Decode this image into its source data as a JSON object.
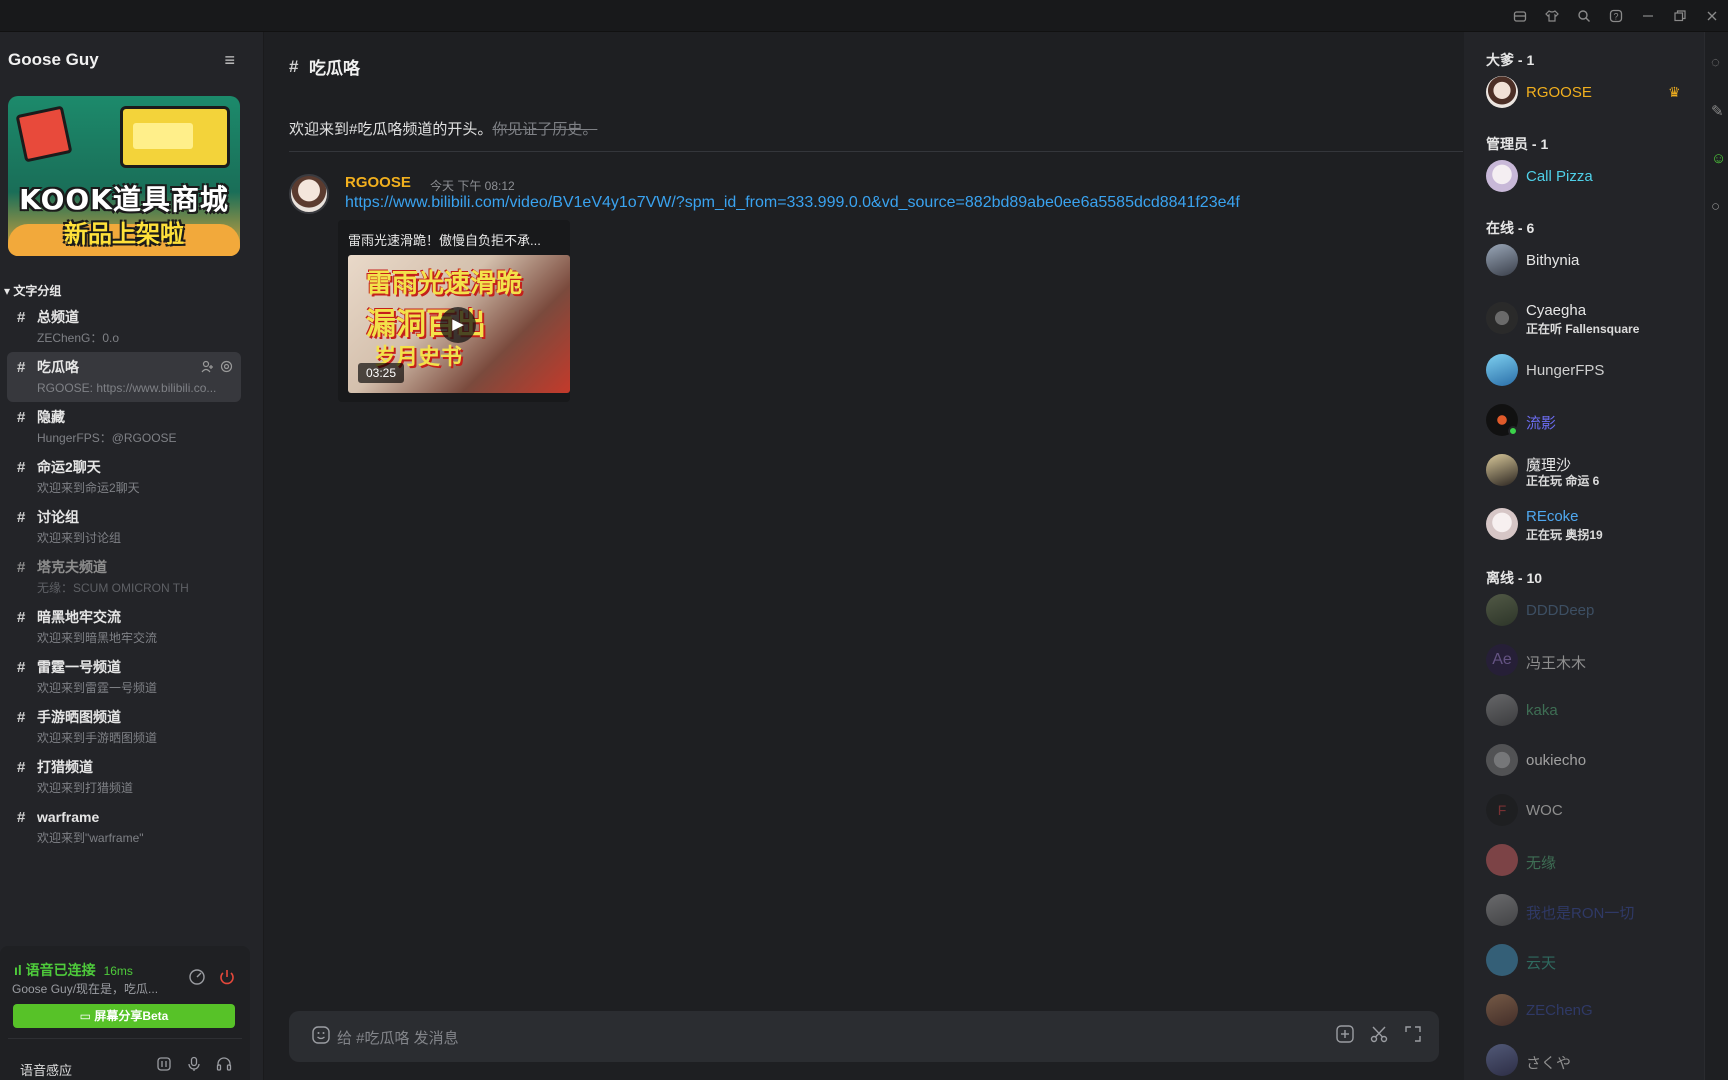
{
  "titlebar": {
    "icons": [
      "inbox-icon",
      "shirt-icon",
      "search-icon",
      "help-icon",
      "minimize-icon",
      "restore-icon",
      "close-icon"
    ]
  },
  "sidebar": {
    "server_name": "Goose Guy",
    "banner": {
      "line1": "KOOK道具商城",
      "line2": "新品上架啦"
    },
    "group_label": "文字分组",
    "channels": [
      {
        "name": "总频道",
        "sub": "ZEChenG：0.o"
      },
      {
        "name": "吃瓜咯",
        "sub": "RGOOSE: https://www.bilibili.co..."
      },
      {
        "name": "隐藏",
        "sub": "HungerFPS：@RGOOSE"
      },
      {
        "name": "命运2聊天",
        "sub": "欢迎来到命运2聊天"
      },
      {
        "name": "讨论组",
        "sub": "欢迎来到讨论组"
      },
      {
        "name": "塔克夫频道",
        "sub": "无缘：SCUM OMICRON TH"
      },
      {
        "name": "暗黑地牢交流",
        "sub": "欢迎来到暗黑地牢交流"
      },
      {
        "name": "雷霆一号频道",
        "sub": "欢迎来到雷霆一号频道"
      },
      {
        "name": "手游晒图频道",
        "sub": "欢迎来到手游晒图频道"
      },
      {
        "name": "打猎频道",
        "sub": "欢迎来到打猎频道"
      },
      {
        "name": "warframe",
        "sub": "欢迎来到\"warframe\""
      }
    ],
    "voice": {
      "status": "语音已连接",
      "ping": "16ms",
      "desc": "Goose Guy/现在是，吃瓜...",
      "share_label": "屏幕分享Beta",
      "mode": "语音感应"
    }
  },
  "main": {
    "channel_title": "吃瓜咯",
    "welcome": "欢迎来到#吃瓜咯频道的开头。",
    "welcome_strike": "你见证了历史。",
    "message": {
      "user": "RGOOSE",
      "time": "今天 下午 08:12",
      "link": "https://www.bilibili.com/video/BV1eV4y1o7VW/?spm_id_from=333.999.0.0&vd_source=882bd89abe0ee6a5585dcd8841f23e4f",
      "embed_title": "雷雨光速滑跪！傲慢自负拒不承...",
      "thumb_line1": "雷雨光速滑跪",
      "thumb_line2": "漏洞百出",
      "thumb_line3": "岁月史书",
      "duration": "03:25"
    },
    "composer_placeholder": "给 #吃瓜咯 发消息"
  },
  "members": {
    "groups": [
      {
        "label": "大爹 - 1"
      },
      {
        "label": "管理员 - 1"
      },
      {
        "label": "在线 - 6"
      },
      {
        "label": "离线 - 10"
      }
    ],
    "items": [
      {
        "name": "RGOOSE",
        "color": "#f2b01e",
        "activity": ""
      },
      {
        "name": "Call Pizza",
        "color": "#4fd0e8",
        "activity": ""
      },
      {
        "name": "Bithynia",
        "color": "#e6e6e6",
        "activity": ""
      },
      {
        "name": "Cyaegha",
        "color": "#e6e6e6",
        "activity": "正在听 Fallensquare"
      },
      {
        "name": "HungerFPS",
        "color": "#cfcfcf",
        "activity": ""
      },
      {
        "name": "流影",
        "color": "#6b6cf0",
        "activity": ""
      },
      {
        "name": "魔理沙",
        "color": "#e6e6e6",
        "activity": "正在玩 命运 6"
      },
      {
        "name": "REcoke",
        "color": "#4fa8f0",
        "activity": "正在玩 奥拐19"
      },
      {
        "name": "DDDDeep",
        "color": "#3d4f63",
        "activity": ""
      },
      {
        "name": "冯王木木",
        "color": "#8e8e8e",
        "activity": ""
      },
      {
        "name": "kaka",
        "color": "#3e6e54",
        "activity": ""
      },
      {
        "name": "oukiecho",
        "color": "#a0a0a0",
        "activity": ""
      },
      {
        "name": "WOC",
        "color": "#8e8e8e",
        "activity": ""
      },
      {
        "name": "无缘",
        "color": "#3e6e54",
        "activity": ""
      },
      {
        "name": "我也是RON一切",
        "color": "#2f3966",
        "activity": ""
      },
      {
        "name": "云天",
        "color": "#2f6a5f",
        "activity": ""
      },
      {
        "name": "ZEChenG",
        "color": "#2f3966",
        "activity": ""
      },
      {
        "name": "さくや",
        "color": "#8e8e8e",
        "activity": ""
      }
    ]
  },
  "colors": {
    "accent_green": "#57c228",
    "owner_gold": "#f2b01e",
    "link_blue": "#3aa3f0"
  }
}
